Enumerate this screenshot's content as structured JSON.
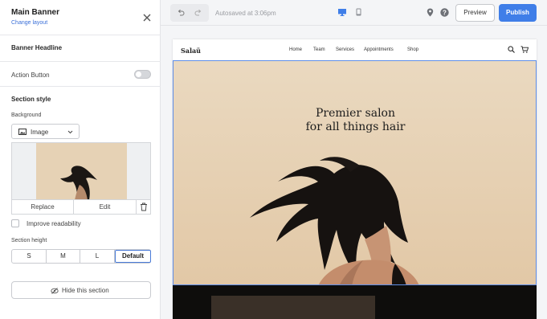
{
  "panel": {
    "title": "Main Banner",
    "change_layout": "Change layout",
    "headline_label": "Banner Headline",
    "action_button_label": "Action Button",
    "action_button_enabled": false,
    "section_style_label": "Section style",
    "background_label": "Background",
    "background_value": "Image",
    "replace_label": "Replace",
    "edit_label": "Edit",
    "improve_readability_label": "Improve readability",
    "improve_readability_checked": false,
    "section_height_label": "Section height",
    "height_options": [
      "S",
      "M",
      "L",
      "Default"
    ],
    "height_selected": "Default",
    "hide_label": "Hide this section"
  },
  "topbar": {
    "autosave": "Autosaved at 3:06pm",
    "preview_label": "Preview",
    "publish_label": "Publish"
  },
  "site": {
    "logo": "Salaü",
    "nav": [
      "Home",
      "Team",
      "Services",
      "Appointments",
      "Shop"
    ],
    "headline_line1": "Premier salon",
    "headline_line2": "for all things hair"
  },
  "colors": {
    "accent": "#3f7ee8",
    "banner_bg": "#e8d6bb",
    "selection_outline": "#5f8ee8"
  }
}
